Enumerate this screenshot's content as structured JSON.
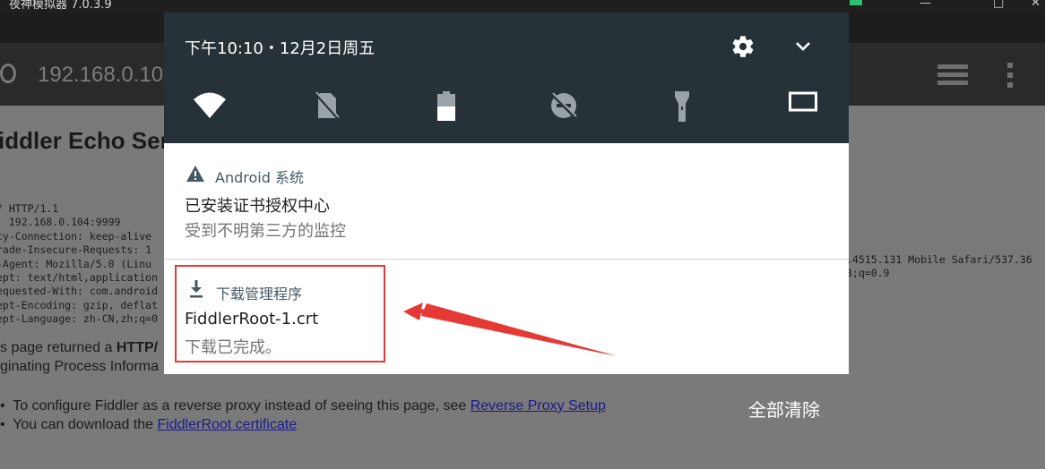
{
  "window": {
    "title": "夜神模拟器 7.0.3.9",
    "controls": [
      "—",
      "□",
      "✕"
    ]
  },
  "browser": {
    "address": "192.168.0.10",
    "page": {
      "heading": "iddler Echo Ser",
      "request_lines": [
        "/ HTTP/1.1",
        ": 192.168.0.104:9999",
        "ty-Connection: keep-alive",
        "rade-Insecure-Requests: 1",
        "-Agent: Mozilla/5.0 (Linu",
        "ept: text/html,application",
        "equested-With: com.android",
        "ept-Encoding: gzip, deflat",
        "ept-Language: zh-CN,zh;q=0"
      ],
      "request_right": [
        ".4515.131 Mobile Safari/537.36",
        "3;q=0.9"
      ],
      "para1_prefix": "s page returned a ",
      "para1_bold": "HTTP/",
      "para2": "ginating Process Informa",
      "bullets": [
        {
          "text": "To configure Fiddler as a reverse proxy instead of seeing this page, see ",
          "link": "Reverse Proxy Setup"
        },
        {
          "text": "You can download the ",
          "link": "FiddlerRoot certificate"
        }
      ]
    }
  },
  "shade": {
    "clock": "下午10:10・12月2日周五",
    "icons": [
      "wifi-icon",
      "no-sim-icon",
      "battery-icon",
      "do-not-disturb-icon",
      "flashlight-icon",
      "screen-cast-icon"
    ]
  },
  "notifications": [
    {
      "app": "Android 系统",
      "title": "已安装证书授权中心",
      "text": "受到不明第三方的监控",
      "icon": "warning-icon"
    },
    {
      "app": "下载管理程序",
      "title": "FiddlerRoot-1.crt",
      "text": "下载已完成。",
      "icon": "download-icon"
    }
  ],
  "clear_all": "全部清除",
  "colors": {
    "shade_bg": "#263238",
    "accent_red": "#e53935",
    "link": "#1a1a8f"
  }
}
